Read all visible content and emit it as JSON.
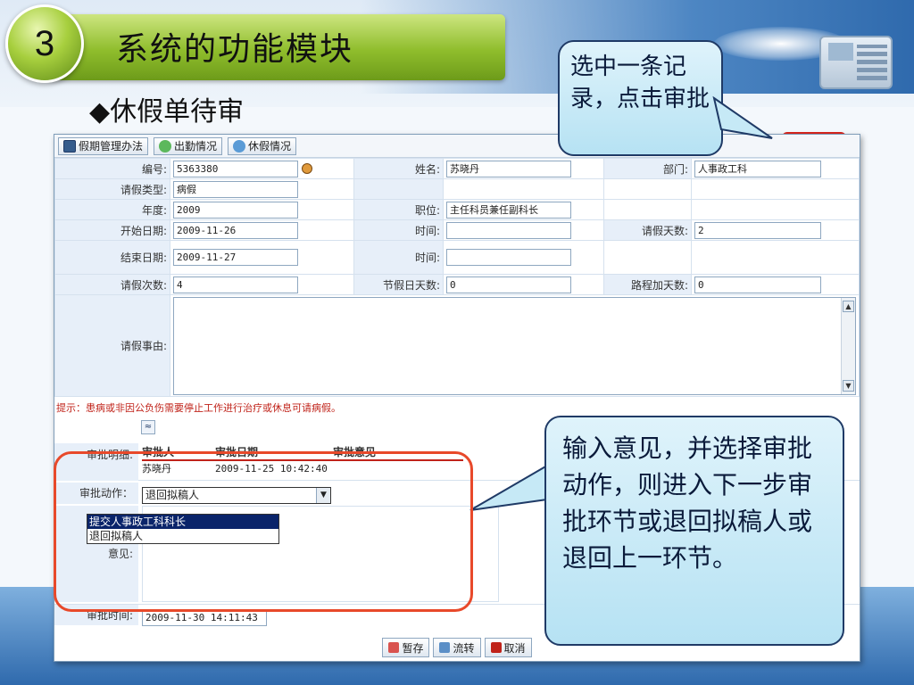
{
  "slide": {
    "number": "3",
    "title": "系统的功能模块",
    "subtitle": "◆休假单待审"
  },
  "callouts": {
    "top": "选中一条记录，点击审批",
    "bottom": "输入意见，并选择审批动作，则进入下一步审批环节或退回拟稿人或退回上一环节。"
  },
  "toolbar": {
    "policy": "假期管理办法",
    "attendance": "出勤情况",
    "leave": "休假情况"
  },
  "form": {
    "id_label": "编号:",
    "id_value": "5363380",
    "name_label": "姓名:",
    "name_value": "苏晓丹",
    "dept_label": "部门:",
    "dept_value": "人事政工科",
    "type_label": "请假类型:",
    "type_value": "病假",
    "year_label": "年度:",
    "year_value": "2009",
    "position_label": "职位:",
    "position_value": "主任科员兼任副科长",
    "start_label": "开始日期:",
    "start_value": "2009-11-26",
    "time1_label": "时间:",
    "time1_value": "",
    "days_label": "请假天数:",
    "days_value": "2",
    "end_label": "结束日期:",
    "end_value": "2009-11-27",
    "time2_label": "时间:",
    "time2_value": "",
    "count_label": "请假次数:",
    "count_value": "4",
    "holiday_label": "节假日天数:",
    "holiday_value": "0",
    "travel_label": "路程加天数:",
    "travel_value": "0",
    "reason_label": "请假事由:",
    "reason_value": ""
  },
  "hint": "提示：患病或非因公负伤需要停止工作进行治疗或休息可请病假。",
  "approval": {
    "detail_label": "审批明细:",
    "col_person": "审批人",
    "col_date": "审批日期",
    "col_opinion": "审批意见",
    "row_person": "苏晓丹",
    "row_date": "2009-11-25 10:42:40",
    "action_label": "审批动作：",
    "action_value": "退回拟稿人",
    "options": [
      "提交人事政工科科长",
      "退回拟稿人"
    ],
    "opinion_label": "意见:",
    "time_label": "审批时间:",
    "time_value": "2009-11-30 14:11:43"
  },
  "buttons": {
    "save": "暂存",
    "flow": "流转",
    "cancel": "取消"
  }
}
